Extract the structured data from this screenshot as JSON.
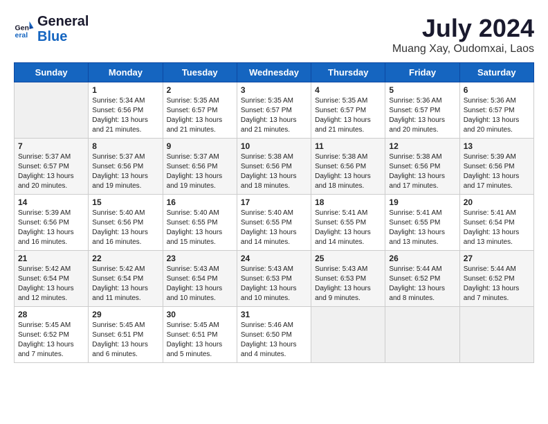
{
  "header": {
    "logo_general": "General",
    "logo_blue": "Blue",
    "month_title": "July 2024",
    "location": "Muang Xay, Oudomxai, Laos"
  },
  "weekdays": [
    "Sunday",
    "Monday",
    "Tuesday",
    "Wednesday",
    "Thursday",
    "Friday",
    "Saturday"
  ],
  "weeks": [
    [
      {
        "day": "",
        "empty": true
      },
      {
        "day": "1",
        "sunrise": "5:34 AM",
        "sunset": "6:56 PM",
        "daylight": "13 hours and 21 minutes."
      },
      {
        "day": "2",
        "sunrise": "5:35 AM",
        "sunset": "6:57 PM",
        "daylight": "13 hours and 21 minutes."
      },
      {
        "day": "3",
        "sunrise": "5:35 AM",
        "sunset": "6:57 PM",
        "daylight": "13 hours and 21 minutes."
      },
      {
        "day": "4",
        "sunrise": "5:35 AM",
        "sunset": "6:57 PM",
        "daylight": "13 hours and 21 minutes."
      },
      {
        "day": "5",
        "sunrise": "5:36 AM",
        "sunset": "6:57 PM",
        "daylight": "13 hours and 20 minutes."
      },
      {
        "day": "6",
        "sunrise": "5:36 AM",
        "sunset": "6:57 PM",
        "daylight": "13 hours and 20 minutes."
      }
    ],
    [
      {
        "day": "7",
        "sunrise": "5:37 AM",
        "sunset": "6:57 PM",
        "daylight": "13 hours and 20 minutes."
      },
      {
        "day": "8",
        "sunrise": "5:37 AM",
        "sunset": "6:56 PM",
        "daylight": "13 hours and 19 minutes."
      },
      {
        "day": "9",
        "sunrise": "5:37 AM",
        "sunset": "6:56 PM",
        "daylight": "13 hours and 19 minutes."
      },
      {
        "day": "10",
        "sunrise": "5:38 AM",
        "sunset": "6:56 PM",
        "daylight": "13 hours and 18 minutes."
      },
      {
        "day": "11",
        "sunrise": "5:38 AM",
        "sunset": "6:56 PM",
        "daylight": "13 hours and 18 minutes."
      },
      {
        "day": "12",
        "sunrise": "5:38 AM",
        "sunset": "6:56 PM",
        "daylight": "13 hours and 17 minutes."
      },
      {
        "day": "13",
        "sunrise": "5:39 AM",
        "sunset": "6:56 PM",
        "daylight": "13 hours and 17 minutes."
      }
    ],
    [
      {
        "day": "14",
        "sunrise": "5:39 AM",
        "sunset": "6:56 PM",
        "daylight": "13 hours and 16 minutes."
      },
      {
        "day": "15",
        "sunrise": "5:40 AM",
        "sunset": "6:56 PM",
        "daylight": "13 hours and 16 minutes."
      },
      {
        "day": "16",
        "sunrise": "5:40 AM",
        "sunset": "6:55 PM",
        "daylight": "13 hours and 15 minutes."
      },
      {
        "day": "17",
        "sunrise": "5:40 AM",
        "sunset": "6:55 PM",
        "daylight": "13 hours and 14 minutes."
      },
      {
        "day": "18",
        "sunrise": "5:41 AM",
        "sunset": "6:55 PM",
        "daylight": "13 hours and 14 minutes."
      },
      {
        "day": "19",
        "sunrise": "5:41 AM",
        "sunset": "6:55 PM",
        "daylight": "13 hours and 13 minutes."
      },
      {
        "day": "20",
        "sunrise": "5:41 AM",
        "sunset": "6:54 PM",
        "daylight": "13 hours and 13 minutes."
      }
    ],
    [
      {
        "day": "21",
        "sunrise": "5:42 AM",
        "sunset": "6:54 PM",
        "daylight": "13 hours and 12 minutes."
      },
      {
        "day": "22",
        "sunrise": "5:42 AM",
        "sunset": "6:54 PM",
        "daylight": "13 hours and 11 minutes."
      },
      {
        "day": "23",
        "sunrise": "5:43 AM",
        "sunset": "6:54 PM",
        "daylight": "13 hours and 10 minutes."
      },
      {
        "day": "24",
        "sunrise": "5:43 AM",
        "sunset": "6:53 PM",
        "daylight": "13 hours and 10 minutes."
      },
      {
        "day": "25",
        "sunrise": "5:43 AM",
        "sunset": "6:53 PM",
        "daylight": "13 hours and 9 minutes."
      },
      {
        "day": "26",
        "sunrise": "5:44 AM",
        "sunset": "6:52 PM",
        "daylight": "13 hours and 8 minutes."
      },
      {
        "day": "27",
        "sunrise": "5:44 AM",
        "sunset": "6:52 PM",
        "daylight": "13 hours and 7 minutes."
      }
    ],
    [
      {
        "day": "28",
        "sunrise": "5:45 AM",
        "sunset": "6:52 PM",
        "daylight": "13 hours and 7 minutes."
      },
      {
        "day": "29",
        "sunrise": "5:45 AM",
        "sunset": "6:51 PM",
        "daylight": "13 hours and 6 minutes."
      },
      {
        "day": "30",
        "sunrise": "5:45 AM",
        "sunset": "6:51 PM",
        "daylight": "13 hours and 5 minutes."
      },
      {
        "day": "31",
        "sunrise": "5:46 AM",
        "sunset": "6:50 PM",
        "daylight": "13 hours and 4 minutes."
      },
      {
        "day": "",
        "empty": true
      },
      {
        "day": "",
        "empty": true
      },
      {
        "day": "",
        "empty": true
      }
    ]
  ]
}
